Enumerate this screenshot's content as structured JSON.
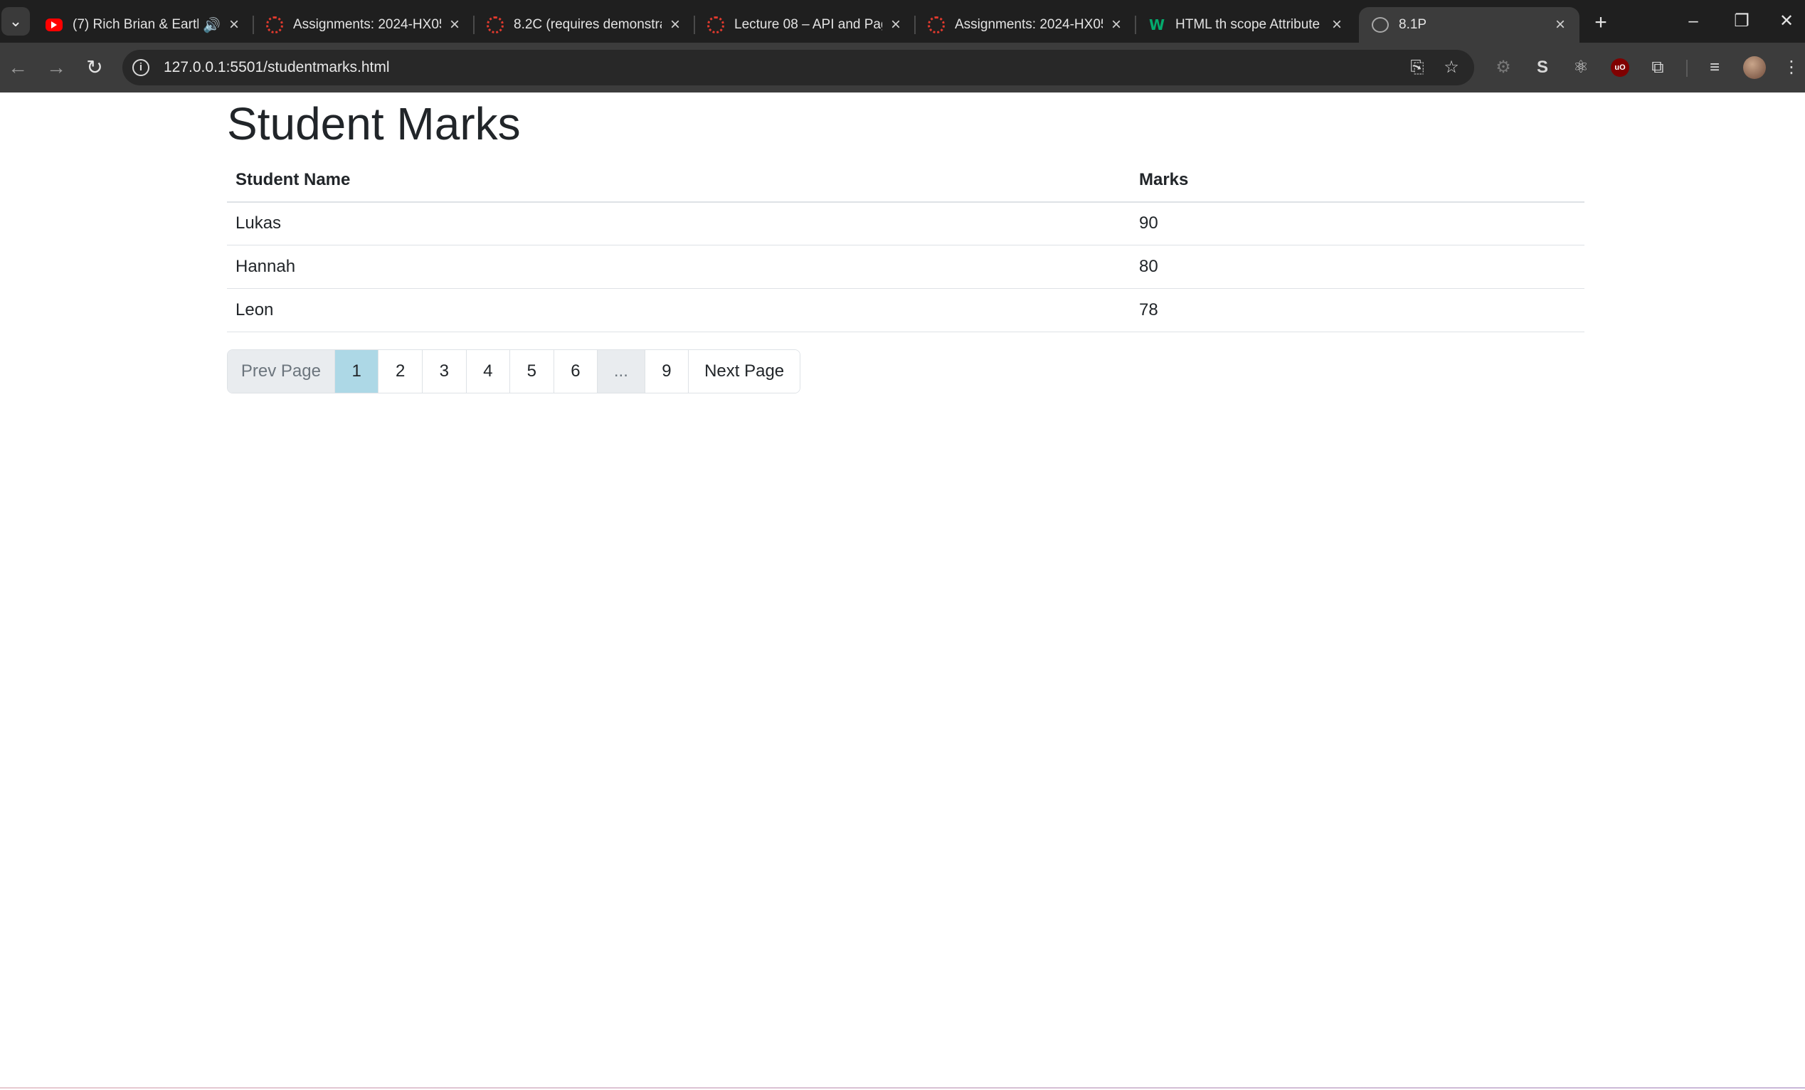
{
  "browser": {
    "tabs": [
      {
        "title": "(7) Rich Brian & Earth",
        "favicon": "youtube-icon",
        "audio": true
      },
      {
        "title": "Assignments: 2024-HX05",
        "favicon": "canvas-icon"
      },
      {
        "title": "8.2C (requires demonstrat",
        "favicon": "canvas-icon"
      },
      {
        "title": "Lecture 08 – API and Pagi",
        "favicon": "canvas-icon"
      },
      {
        "title": "Assignments: 2024-HX05",
        "favicon": "canvas-icon"
      },
      {
        "title": "HTML th scope Attribute",
        "favicon": "w3schools-icon"
      },
      {
        "title": "8.1P",
        "favicon": "globe-icon",
        "active": true
      }
    ],
    "url": "127.0.0.1:5501/studentmarks.html"
  },
  "page": {
    "title": "Student Marks",
    "table": {
      "headers": [
        "Student Name",
        "Marks"
      ],
      "rows": [
        [
          "Lukas",
          "90"
        ],
        [
          "Hannah",
          "80"
        ],
        [
          "Leon",
          "78"
        ]
      ]
    },
    "pagination": {
      "prev_label": "Prev Page",
      "pages": [
        "1",
        "2",
        "3",
        "4",
        "5",
        "6"
      ],
      "ellipsis": "...",
      "last_page": "9",
      "next_label": "Next Page",
      "current": "1"
    }
  },
  "colors": {
    "active_page": "#add8e6",
    "disabled_bg": "#e9ecef",
    "text": "#212529"
  }
}
